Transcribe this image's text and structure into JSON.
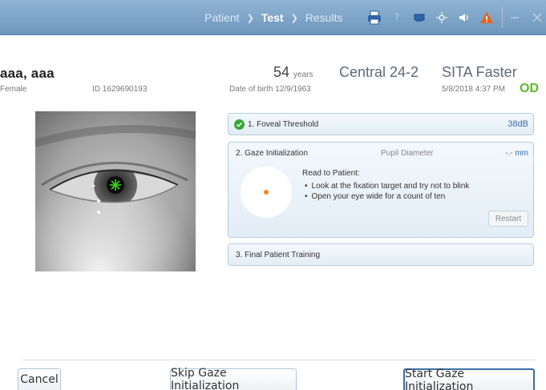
{
  "nav": {
    "breadcrumb": [
      "Patient",
      "Test",
      "Results"
    ],
    "icons": [
      "printer-icon",
      "help-icon",
      "monitor-icon",
      "brightness-icon",
      "volume-icon",
      "warning-icon",
      "minimize-icon",
      "close-icon"
    ]
  },
  "patient": {
    "name": "aaa, aaa",
    "sex": "Female",
    "id": "ID 1629690193",
    "age": "54",
    "age_unit": "years",
    "dob": "Date of birth  12/9/1963"
  },
  "test": {
    "pattern": "Central 24-2",
    "strategy": "SITA Faster",
    "datetime": "5/8/2018 4:37 PM",
    "eye": "OD"
  },
  "steps": {
    "foveal": {
      "title": "1. Foveal Threshold",
      "value": "38dB"
    },
    "gaze": {
      "title": "2. Gaze Initialization",
      "pupil_label": "Pupil Diameter",
      "pupil_value": "-.- mm",
      "read_label": "Read to Patient:",
      "instructions": [
        "Look at the fixation target and try not to blink",
        "Open your eye wide for a count of ten"
      ],
      "restart_label": "Restart"
    },
    "final": {
      "title": "3. Final Patient Training"
    }
  },
  "footer": {
    "cancel_label": "Cancel",
    "skip_label": "Skip Gaze Initialization",
    "start_label": "Start Gaze Initialization"
  },
  "colors": {
    "topbar": "#7aa2c8",
    "eye_label": "#5cb82a",
    "accent_blue": "#3a6ea8",
    "gaze_dot": "#f08a24"
  }
}
